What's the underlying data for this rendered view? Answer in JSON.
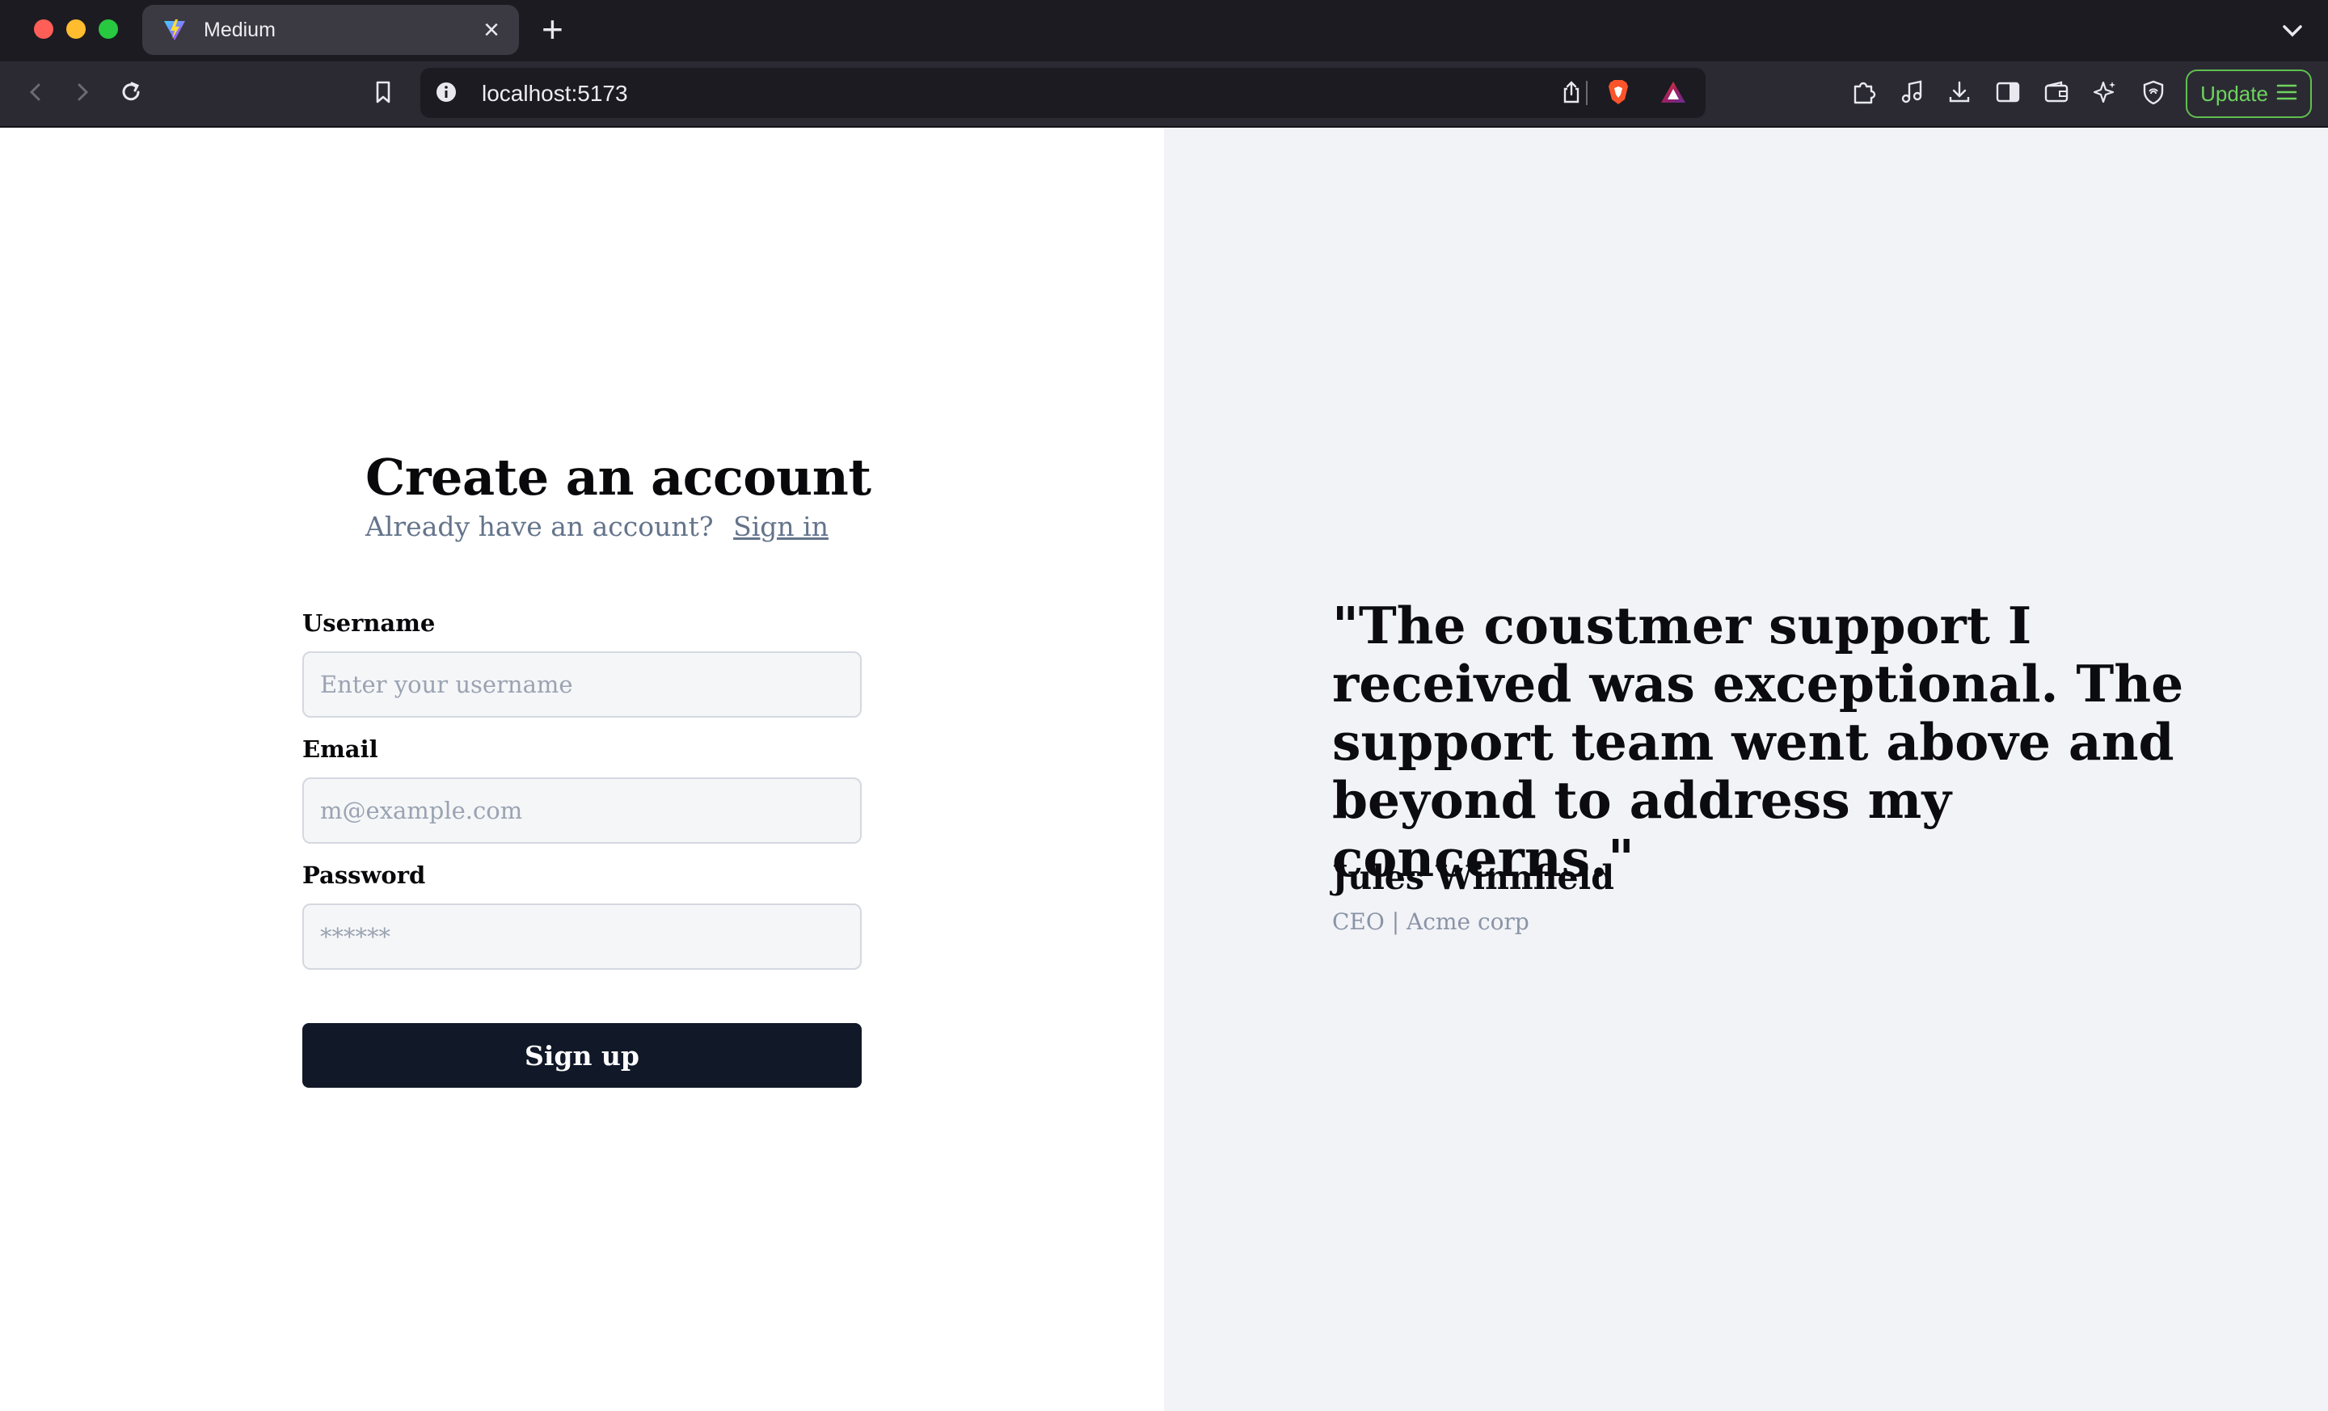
{
  "browser": {
    "tab_title": "Medium",
    "url": "localhost:5173",
    "update_label": "Update"
  },
  "form": {
    "heading": "Create an account",
    "subtitle": "Already have an account?",
    "signin_link": "Sign in",
    "username_label": "Username",
    "username_placeholder": "Enter your username",
    "email_label": "Email",
    "email_placeholder": "m@example.com",
    "password_label": "Password",
    "password_placeholder": "******",
    "submit_label": "Sign up"
  },
  "testimonial": {
    "quote": "\"The coustmer support I received was exceptional. The support team went above and beyond to address my concerns.\"",
    "author": "Jules Winnfield",
    "role": "CEO | Acme corp"
  },
  "colors": {
    "button_bg": "#111827",
    "right_pane_bg": "#f2f3f7",
    "update_accent": "#6fd35d"
  }
}
